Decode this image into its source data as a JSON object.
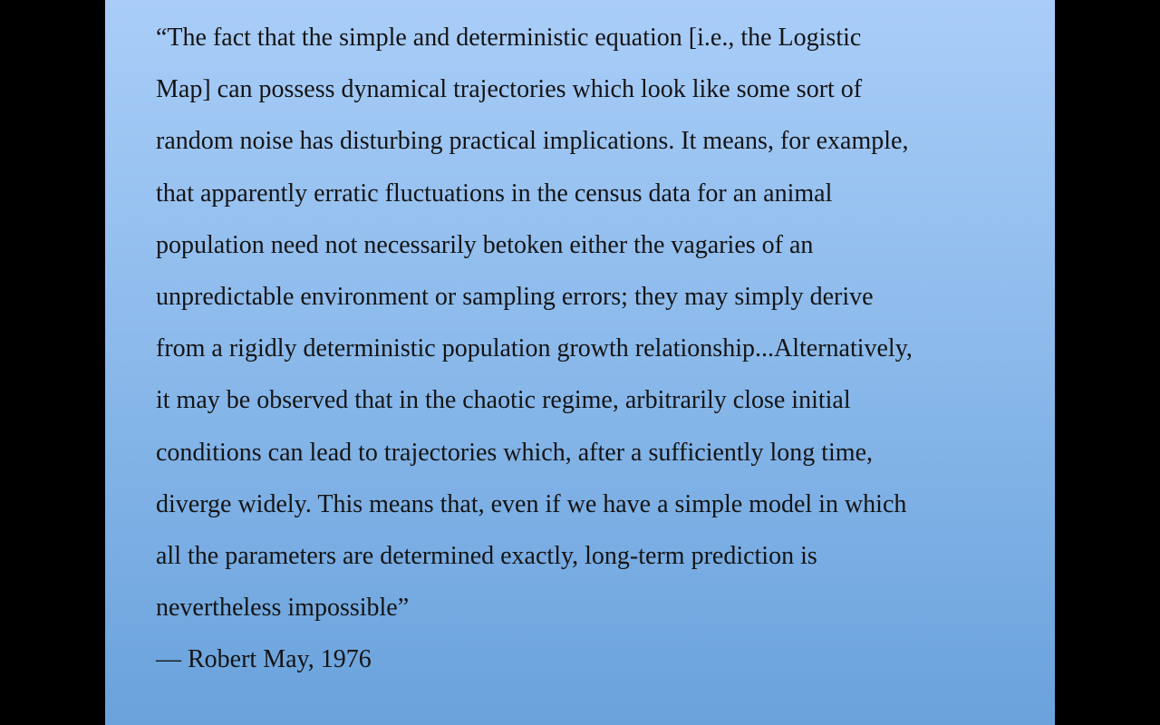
{
  "slide": {
    "quote_lines": [
      "“The fact that the simple and deterministic equation [i.e., the Logistic",
      "Map] can possess dynamical trajectories which look like some sort of",
      "random noise has disturbing practical implications.  It means, for example,",
      "that apparently erratic fluctuations in the census data for an animal",
      "population need not necessarily betoken either the vagaries of an",
      "unpredictable environment or sampling errors; they may simply derive",
      "from a rigidly deterministic population growth relationship...Alternatively,",
      "it may be observed that in the chaotic regime, arbitrarily close initial",
      "conditions can lead to trajectories which, after a sufficiently long time,",
      "diverge widely.  This means that, even if we have a simple model in which",
      "all the parameters are determined exactly, long-term prediction is",
      "nevertheless impossible”"
    ],
    "attribution": "— Robert May, 1976"
  },
  "colors": {
    "letterbox": "#000000",
    "slide_top": "#a9cdf8",
    "slide_bottom": "#6aa2dc",
    "text": "#141414"
  }
}
